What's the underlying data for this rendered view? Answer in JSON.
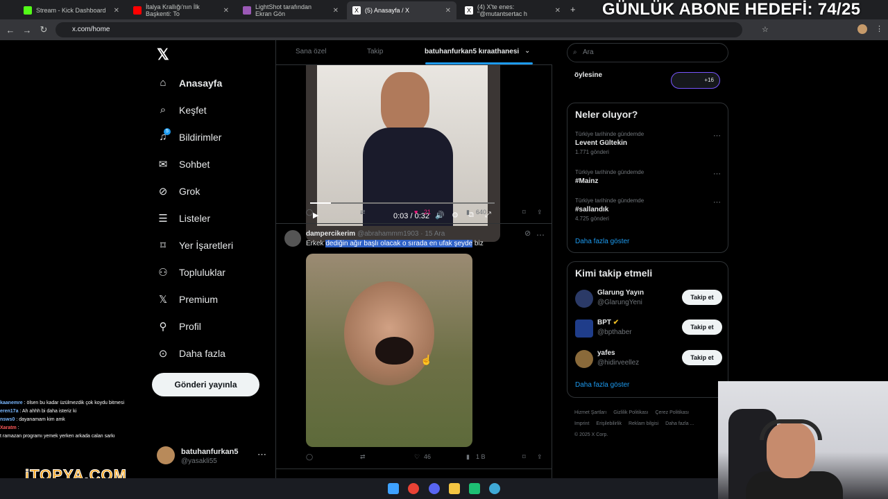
{
  "browser": {
    "tabs": [
      {
        "title": "Stream - Kick Dashboard",
        "color": "#53fc18"
      },
      {
        "title": "İtalya Krallığı'nın İlk Başkenti: To",
        "color": "#ff0000"
      },
      {
        "title": "LightShot tarafından Ekran Gön",
        "color": "#9b59b6"
      },
      {
        "title": "(5) Anasayfa / X",
        "color": "#000000"
      },
      {
        "title": "(4) X'te enes: \"@mutantsertac h",
        "color": "#000000"
      }
    ],
    "url": "x.com/home"
  },
  "overlay_text": "GÜNLÜK ABONE HEDEFİ: 74/25",
  "nav": {
    "items": [
      {
        "label": "Anasayfa",
        "icon": "home-icon"
      },
      {
        "label": "Keşfet",
        "icon": "search-icon"
      },
      {
        "label": "Bildirimler",
        "icon": "bell-icon",
        "badge": "5"
      },
      {
        "label": "Sohbet",
        "icon": "mail-icon"
      },
      {
        "label": "Grok",
        "icon": "grok-icon"
      },
      {
        "label": "Listeler",
        "icon": "list-icon"
      },
      {
        "label": "Yer İşaretleri",
        "icon": "bookmark-icon"
      },
      {
        "label": "Topluluklar",
        "icon": "people-icon"
      },
      {
        "label": "Premium",
        "icon": "x-icon"
      },
      {
        "label": "Profil",
        "icon": "person-icon"
      },
      {
        "label": "Daha fazla",
        "icon": "more-circle-icon"
      }
    ],
    "post_button": "Gönderi yayınla",
    "account": {
      "name": "batuhanfurkan5",
      "handle": "@yasakli55"
    }
  },
  "feed": {
    "tabs": [
      "Sana özel",
      "Takip",
      "batuhanfurkan5 kıraathanesi"
    ],
    "post1": {
      "video_time": "0:03 / 0:32",
      "likes": "21",
      "views": "640"
    },
    "post2": {
      "name": "dampercikerim",
      "handle": "@abrahammm1903",
      "date": "· 15 Ara",
      "text_plain": "Erkek ",
      "text_selected": "dediğin ağır başlı olacak o sırada en ufak şeyde",
      "text_tail": " biz",
      "likes": "46",
      "views": "1 B"
    }
  },
  "right": {
    "search_placeholder": "Ara",
    "community": {
      "name": "öylesine",
      "badge": "+16"
    },
    "trends_title": "Neler oluyor?",
    "trends": [
      {
        "context": "Türkiye tarihinde gündemde",
        "name": "Levent Gültekin",
        "count": "1.771 gönderi"
      },
      {
        "context": "Türkiye tarihinde gündemde",
        "name": "#Mainz",
        "count": ""
      },
      {
        "context": "Türkiye tarihinde gündemde",
        "name": "#sallandık",
        "count": "4.725 gönderi"
      }
    ],
    "show_more": "Daha fazla göster",
    "who_title": "Kimi takip etmeli",
    "who": [
      {
        "name": "Glarung Yayın",
        "handle": "@GlarungYeni",
        "button": "Takip et",
        "color": "#2b3a67"
      },
      {
        "name": "BPT",
        "handle": "@bpthaber",
        "button": "Takip et",
        "color": "#1f3d8a"
      },
      {
        "name": "yafes",
        "handle": "@hidirveellez",
        "button": "Takip et",
        "color": "#8a6a3a"
      }
    ],
    "footer": [
      "Hizmet Şartları",
      "Gizlilik Politikası",
      "Çerez Politikası",
      "Imprint",
      "Erişilebilirlik",
      "Reklam bilgisi",
      "Daha fazla ...",
      "© 2025 X Corp."
    ]
  },
  "chat": [
    {
      "user": "kaanemre",
      "msg": ": ölsen bu kadar üzülmezdik çok koydu bitmesi",
      "color": "#7ab8ff"
    },
    {
      "user": "eren17a",
      "msg": ": Ah ahhh bi daha isteriz ki",
      "color": "#7ab8ff"
    },
    {
      "user": "nsws0",
      "msg": ": dayanamam kim amk",
      "color": "#7ab8ff"
    },
    {
      "user": "Xaratm",
      "msg": ":",
      "color": "#ff5a5a"
    },
    {
      "user": "",
      "msg": "t ramazan programı yemek yerken arkada calan sarkı",
      "color": "#ffffff"
    }
  ],
  "brand": "iTOPYA.COM"
}
